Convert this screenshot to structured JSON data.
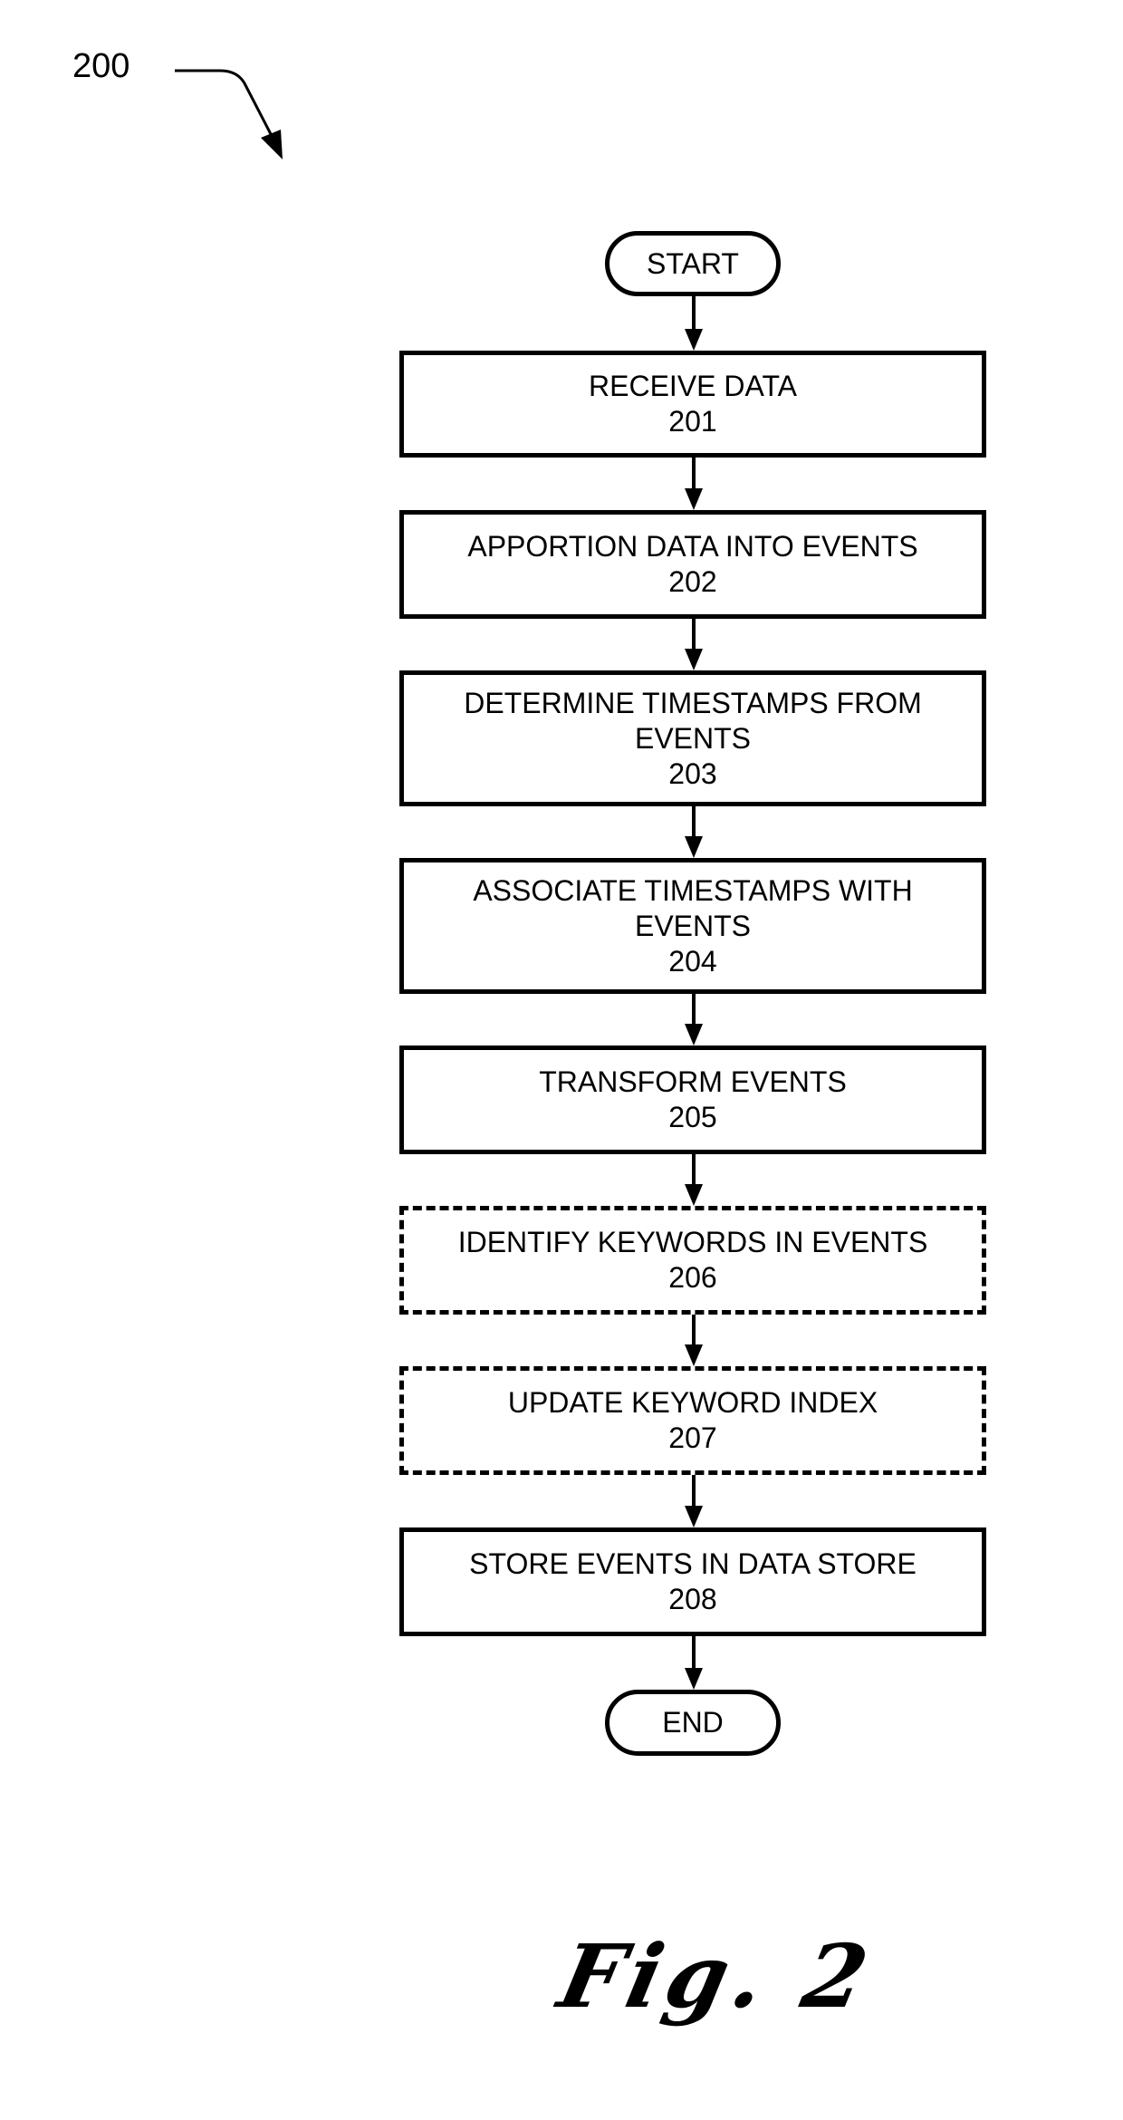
{
  "figure": {
    "reference_numeral": "200",
    "caption": "Fig. 2"
  },
  "flowchart": {
    "start": "START",
    "end": "END",
    "steps": [
      {
        "label": "RECEIVE DATA",
        "number": "201",
        "style": "solid"
      },
      {
        "label": "APPORTION DATA INTO EVENTS",
        "number": "202",
        "style": "solid"
      },
      {
        "label": "DETERMINE TIMESTAMPS FROM EVENTS",
        "number": "203",
        "style": "solid"
      },
      {
        "label": "ASSOCIATE TIMESTAMPS WITH EVENTS",
        "number": "204",
        "style": "solid"
      },
      {
        "label": "TRANSFORM EVENTS",
        "number": "205",
        "style": "solid"
      },
      {
        "label": "IDENTIFY KEYWORDS IN EVENTS",
        "number": "206",
        "style": "dashed"
      },
      {
        "label": "UPDATE KEYWORD INDEX",
        "number": "207",
        "style": "dashed"
      },
      {
        "label": "STORE EVENTS IN DATA STORE",
        "number": "208",
        "style": "solid"
      }
    ]
  }
}
